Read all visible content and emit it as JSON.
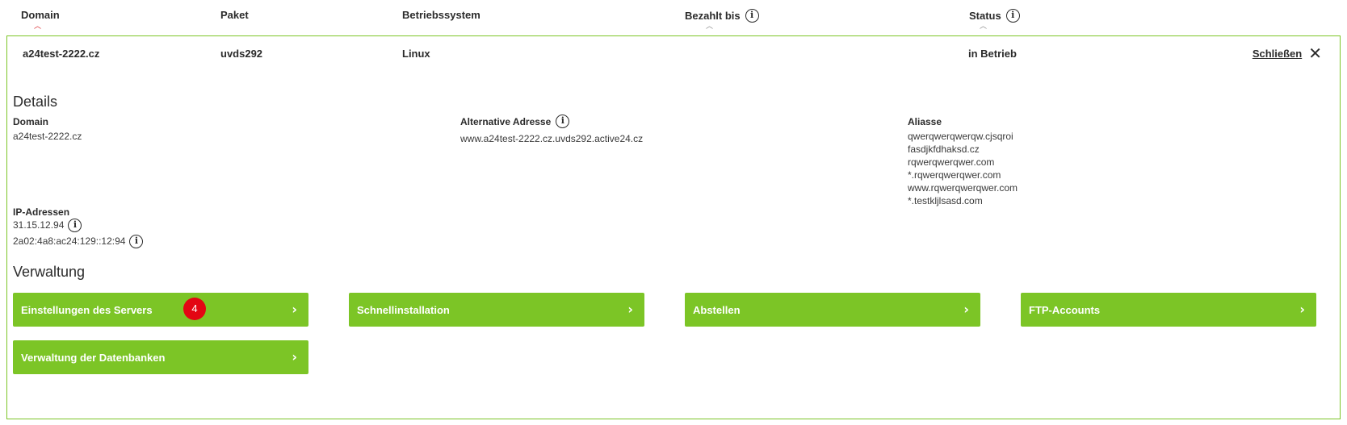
{
  "header": {
    "columns": [
      {
        "label": "Domain"
      },
      {
        "label": "Paket"
      },
      {
        "label": "Betriebssystem"
      },
      {
        "label": "Bezahlt bis"
      },
      {
        "label": "Status"
      }
    ]
  },
  "row": {
    "domain": "a24test-2222.cz",
    "paket": "uvds292",
    "os": "Linux",
    "status": "in Betrieb",
    "close_label": "Schließen"
  },
  "details": {
    "title": "Details",
    "domain_label": "Domain",
    "domain_value": "a24test-2222.cz",
    "alt_label": "Alternative Adresse",
    "alt_value": "www.a24test-2222.cz.uvds292.active24.cz",
    "aliases_label": "Aliasse",
    "aliases": [
      "qwerqwerqwerqw.cjsqroi",
      "fasdjkfdhaksd.cz",
      "rqwerqwerqwer.com",
      "*.rqwerqwerqwer.com",
      "www.rqwerqwerqwer.com",
      "*.testkljlsasd.com"
    ],
    "ip_label": "IP-Adressen",
    "ips": [
      "31.15.12.94",
      "2a02:4a8:ac24:129::12:94"
    ]
  },
  "management": {
    "title": "Verwaltung",
    "buttons": [
      {
        "label": "Einstellungen des Servers",
        "badge": "4"
      },
      {
        "label": "Schnellinstallation"
      },
      {
        "label": "Abstellen"
      },
      {
        "label": "FTP-Accounts"
      },
      {
        "label": "Verwaltung der Datenbanken"
      }
    ]
  },
  "colors": {
    "accent": "#7cc526",
    "badge": "#e30613",
    "sort_active": "#d9262b"
  },
  "icons": {
    "info": "info-circle-icon",
    "close": "close-icon",
    "chevron": "chevron-right-icon",
    "sort": "sort-arrow-up-icon"
  }
}
